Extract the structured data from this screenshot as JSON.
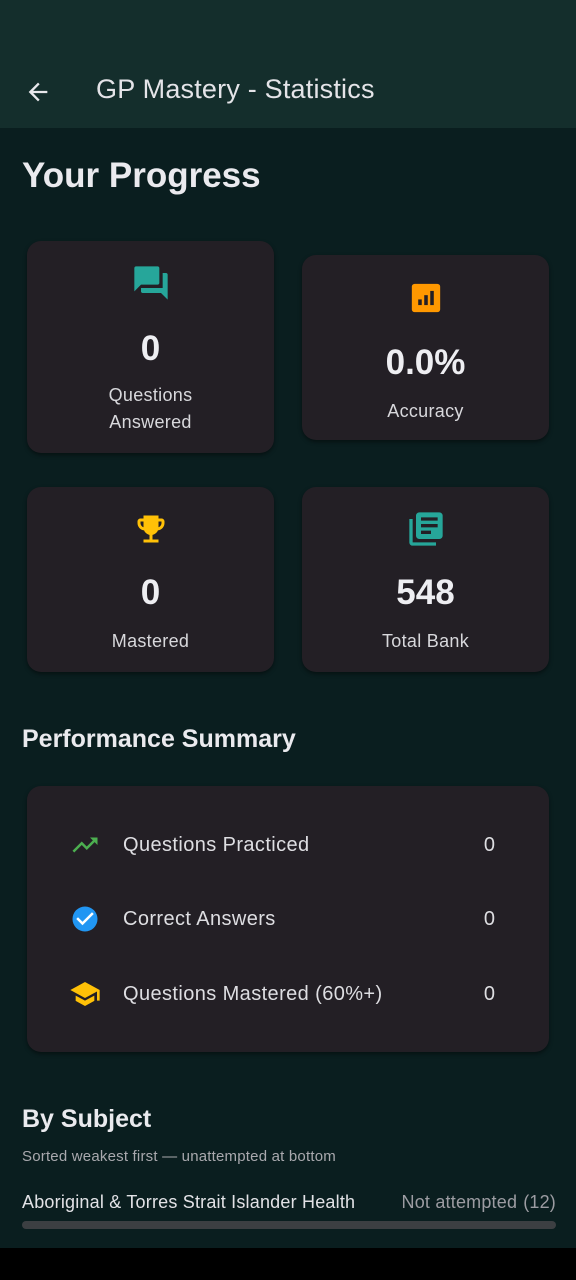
{
  "app_bar": {
    "title": "GP Mastery - Statistics",
    "back_icon": "arrow-back-icon"
  },
  "progress": {
    "heading": "Your Progress",
    "cards": [
      {
        "icon": "forum-icon",
        "icon_color": "#26a69a",
        "value": "0",
        "label_line1": "Questions",
        "label_line2": "Answered"
      },
      {
        "icon": "bar-chart-icon",
        "icon_color": "#ff9800",
        "value": "0.0%",
        "label_line1": "Accuracy"
      },
      {
        "icon": "trophy-icon",
        "icon_color": "#ffc107",
        "value": "0",
        "label_line1": "Mastered"
      },
      {
        "icon": "library-books-icon",
        "icon_color": "#26a69a",
        "value": "548",
        "label_line1": "Total Bank"
      }
    ]
  },
  "performance": {
    "heading": "Performance Summary",
    "rows": [
      {
        "icon": "trending-up-icon",
        "icon_color": "#4caf50",
        "label": "Questions Practiced",
        "value": "0"
      },
      {
        "icon": "check-circle-icon",
        "icon_color": "#2196f3",
        "label": "Correct Answers",
        "value": "0"
      },
      {
        "icon": "school-icon",
        "icon_color": "#ffc107",
        "label": "Questions Mastered (60%+)",
        "value": "0"
      }
    ]
  },
  "by_subject": {
    "heading": "By Subject",
    "subtitle": "Sorted weakest first — unattempted at bottom",
    "items": [
      {
        "name": "Aboriginal & Torres Strait Islander Health",
        "status": "Not attempted",
        "count": "(12)",
        "progress": 0
      }
    ]
  },
  "colors": {
    "background": "#0a1e1f",
    "app_bar": "#142e2c",
    "card": "#231f25"
  }
}
